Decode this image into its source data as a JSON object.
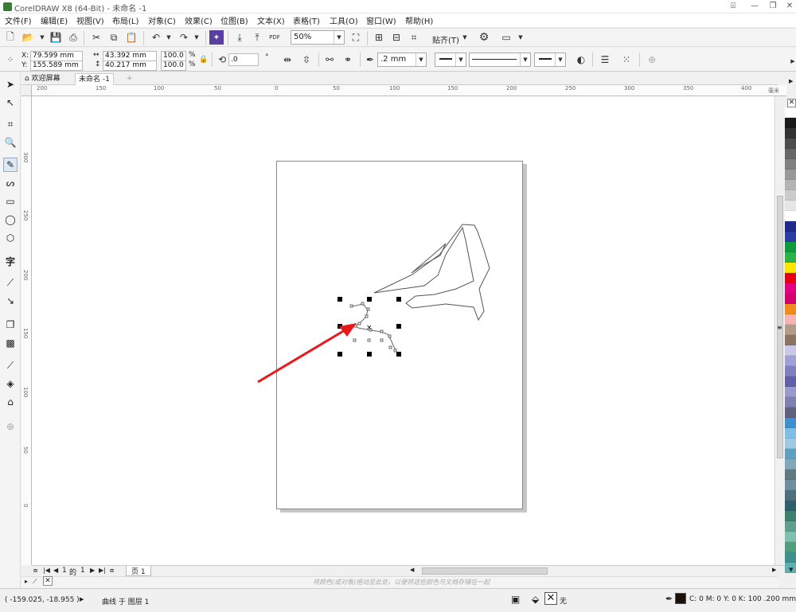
{
  "window": {
    "title": "CorelDRAW X8 (64-Bit) - 未命名 -1",
    "minimize": "□",
    "restore": "❐",
    "close": "✕"
  },
  "menu": [
    "文件(F)",
    "编辑(E)",
    "视图(V)",
    "布局(L)",
    "对象(C)",
    "效果(C)",
    "位图(B)",
    "文本(X)",
    "表格(T)",
    "工具(O)",
    "窗口(W)",
    "帮助(H)"
  ],
  "toolbar": {
    "zoom": "50%",
    "snap_label": "贴齐(T)",
    "pdf": "PDF"
  },
  "propbar": {
    "x_label": "X:",
    "x": "79.599 mm",
    "y_label": "Y:",
    "y": "155.589 mm",
    "w": "43.392 mm",
    "h": "40.217 mm",
    "sx": "100.0",
    "sy": "100.0",
    "pct1": "%",
    "pct2": "%",
    "rotation": ".0",
    "outline_width": ".2 mm"
  },
  "tabs": {
    "welcome": "欢迎屏幕",
    "document": "未命名 -1",
    "add": "+"
  },
  "hruler_ticks": [
    "200",
    "150",
    "100",
    "50",
    "0",
    "50",
    "100",
    "150",
    "200",
    "250",
    "300",
    "350",
    "400"
  ],
  "hruler_unit": "毫米",
  "vruler_ticks": [
    "300",
    "250",
    "200",
    "150",
    "100",
    "50",
    "0"
  ],
  "pager": {
    "current": "1",
    "of": "的",
    "total": "1",
    "page_tab": "页 1"
  },
  "docpal_hint": "将颜色(或对象)拖动至此处，以便将这些颜色与文档存储在一起",
  "status": {
    "coords": "( -159.025, -18.955 )",
    "object_info": "曲线 于 图层 1",
    "fill_none": "无",
    "outline_info": "C: 0 M: 0 Y: 0 K: 100  .200 mm"
  },
  "colors": {
    "arrow": "#e8191a",
    "accent": "#5b3fa0"
  },
  "palette": [
    "#ffffff",
    "#1a1a1a",
    "#333333",
    "#4d4d4d",
    "#666666",
    "#808080",
    "#999999",
    "#b3b3b3",
    "#cccccc",
    "#e6e6e6",
    "#ffffff",
    "#1f2a8a",
    "#2a3fa6",
    "#0e9a3f",
    "#2ab34a",
    "#ffe500",
    "#e60012",
    "#e4007f",
    "#d6006f",
    "#f08b1d",
    "#f7b3b3",
    "#b39b87",
    "#8c7560",
    "#c8c8e6",
    "#a0a0d8",
    "#8080c0",
    "#6060a8",
    "#9999cc",
    "#7f7fb2",
    "#606080",
    "#3f8fd0",
    "#7fbfe6",
    "#9fc9e0",
    "#5fa0c0",
    "#80a8b8",
    "#607880",
    "#6f8f9f",
    "#4f6f7f",
    "#2f5f6f",
    "#3f7f6f",
    "#5f9f8f",
    "#7fbfaf",
    "#4f9f7f",
    "#3f8f8f",
    "#5fafaf"
  ]
}
